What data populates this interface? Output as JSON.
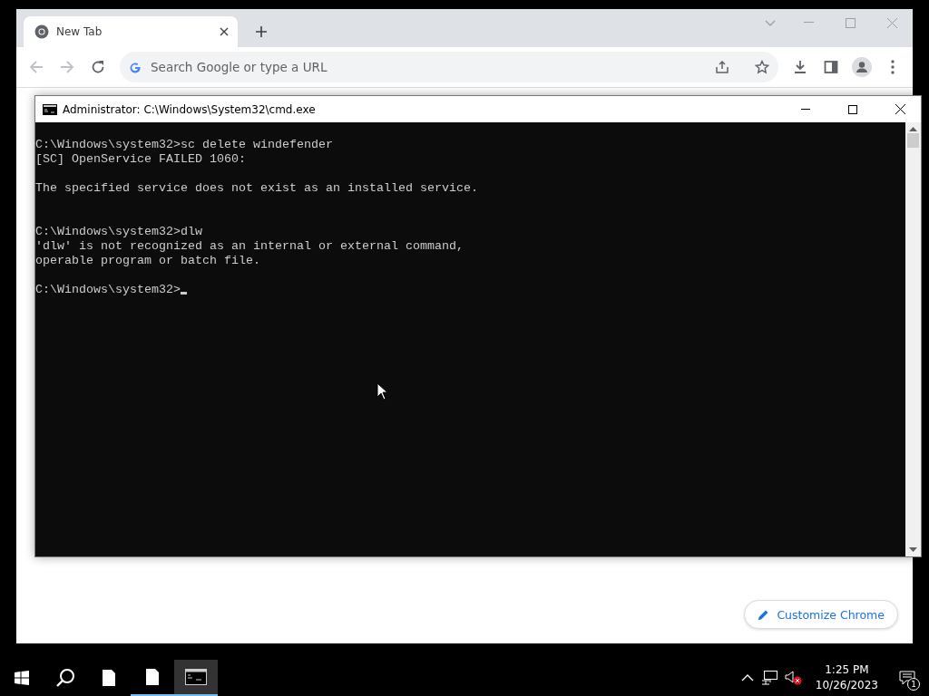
{
  "browser": {
    "tab": {
      "title": "New Tab",
      "selected": true
    },
    "address": {
      "placeholder": "Search Google or type a URL"
    },
    "customize_button": "Customize Chrome"
  },
  "console": {
    "title": "Administrator: C:\\Windows\\System32\\cmd.exe",
    "lines": [
      {
        "kind": "text",
        "text": "C:\\Windows\\system32>sc delete windefender",
        "cursor": false
      },
      {
        "kind": "text",
        "text": "[SC] OpenService FAILED 1060:",
        "cursor": false
      },
      {
        "kind": "blank"
      },
      {
        "kind": "text",
        "text": "The specified service does not exist as an installed service.",
        "cursor": false
      },
      {
        "kind": "blank"
      },
      {
        "kind": "blank"
      },
      {
        "kind": "text",
        "text": "C:\\Windows\\system32>dlw",
        "cursor": false
      },
      {
        "kind": "text",
        "text": "'dlw' is not recognized as an internal or external command,",
        "cursor": false
      },
      {
        "kind": "text",
        "text": "operable program or batch file.",
        "cursor": false
      },
      {
        "kind": "blank"
      },
      {
        "kind": "text",
        "text": "C:\\Windows\\system32>",
        "cursor": true
      }
    ]
  },
  "taskbar": {
    "apps": [
      {
        "kind": "file",
        "running": false,
        "selected": false
      },
      {
        "kind": "file",
        "running": true,
        "selected": false
      },
      {
        "kind": "console",
        "running": true,
        "selected": true
      }
    ],
    "clock": {
      "time": "1:25 PM",
      "date": "10/26/2023"
    },
    "notifications": {
      "count": "1"
    }
  }
}
